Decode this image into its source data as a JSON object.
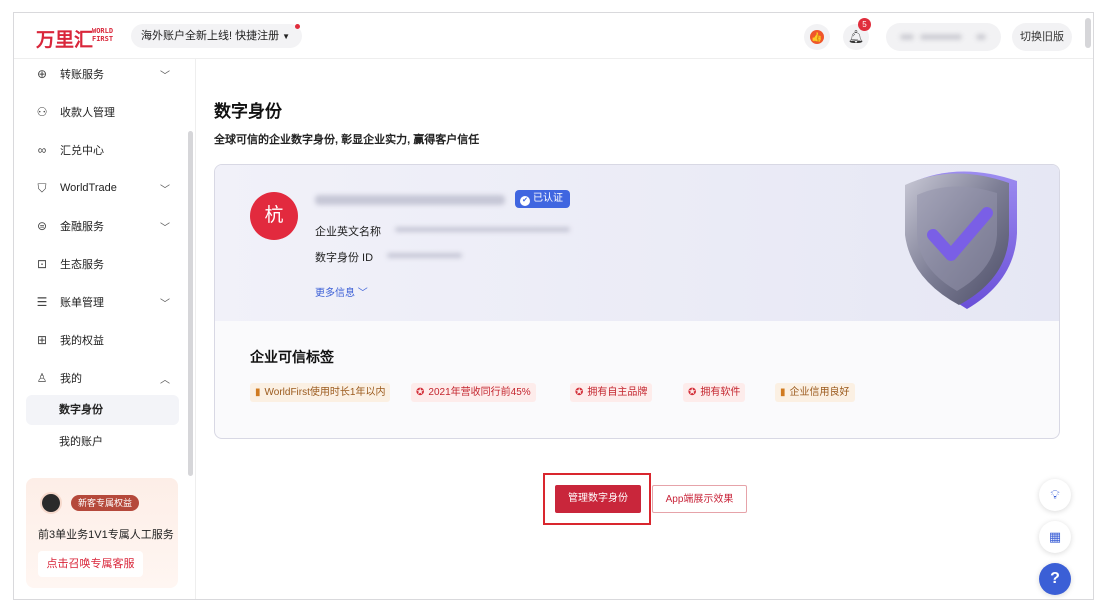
{
  "header": {
    "logo_cn": "万里汇",
    "logo_en_line1": "WORLD",
    "logo_en_line2": "FIRST",
    "promo_text": "海外账户全新上线! 快捷注册",
    "notification_count": "5",
    "switch_label": "切换旧版"
  },
  "sidebar": {
    "items": [
      {
        "label": "转账服务",
        "icon": "transfer-icon",
        "expandable": true
      },
      {
        "label": "收款人管理",
        "icon": "payee-icon",
        "expandable": false
      },
      {
        "label": "汇兑中心",
        "icon": "exchange-icon",
        "expandable": false
      },
      {
        "label": "WorldTrade",
        "icon": "worldtrade-icon",
        "expandable": true
      },
      {
        "label": "金融服务",
        "icon": "finance-icon",
        "expandable": true
      },
      {
        "label": "生态服务",
        "icon": "ecosystem-icon",
        "expandable": false
      },
      {
        "label": "账单管理",
        "icon": "bill-icon",
        "expandable": true
      },
      {
        "label": "我的权益",
        "icon": "gift-icon",
        "expandable": false
      },
      {
        "label": "我的",
        "icon": "user-icon",
        "expandable": true
      }
    ],
    "sub_items": [
      {
        "label": "数字身份",
        "active": true
      },
      {
        "label": "我的账户",
        "active": false
      }
    ],
    "vip": {
      "tag": "新客专属权益",
      "text": "前3单业务1V1专属人工服务",
      "button": "点击召唤专属客服"
    }
  },
  "main": {
    "title": "数字身份",
    "subtitle": "全球可信的企业数字身份, 彰显企业实力, 赢得客户信任",
    "avatar_char": "杭",
    "verified_label": "已认证",
    "english_name_label": "企业英文名称",
    "id_label": "数字身份 ID",
    "more_info": "更多信息",
    "tags_title": "企业可信标签",
    "tags": [
      {
        "label": "WorldFirst使用时长1年以内",
        "style": "gold"
      },
      {
        "label": "2021年营收同行前45%",
        "style": "red"
      },
      {
        "label": "拥有自主品牌",
        "style": "red"
      },
      {
        "label": "拥有软件",
        "style": "red"
      },
      {
        "label": "企业信用良好",
        "style": "gold"
      }
    ],
    "manage_button": "管理数字身份",
    "app_button": "App端展示效果",
    "help_symbol": "?"
  },
  "colors": {
    "brand_red": "#d9263a",
    "accent_blue": "#3b5fd6",
    "verified_blue": "#4066e0"
  }
}
